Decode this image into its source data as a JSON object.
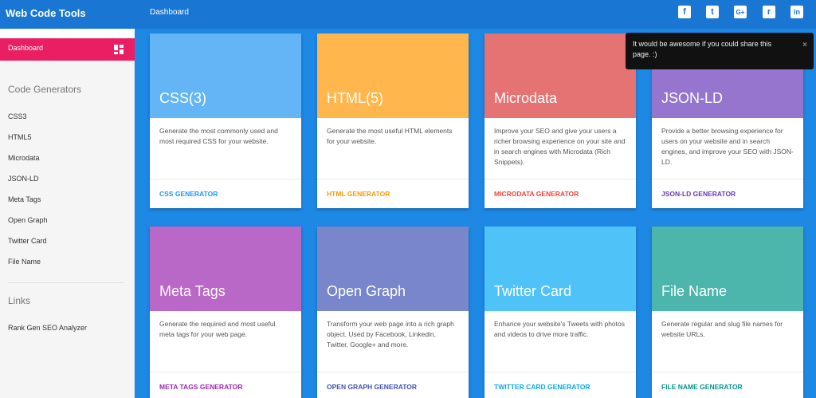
{
  "app": {
    "title": "Web Code Tools"
  },
  "breadcrumb": "Dashboard",
  "social": [
    {
      "name": "facebook-icon",
      "glyph": "f"
    },
    {
      "name": "twitter-icon",
      "glyph": "t"
    },
    {
      "name": "google-plus-icon",
      "glyph": "G+"
    },
    {
      "name": "reddit-icon",
      "glyph": "r"
    },
    {
      "name": "linkedin-icon",
      "glyph": "in"
    }
  ],
  "sidebar": {
    "dashboard_label": "Dashboard",
    "code_generators_title": "Code Generators",
    "items": [
      "CSS3",
      "HTML5",
      "Microdata",
      "JSON-LD",
      "Meta Tags",
      "Open Graph",
      "Twitter Card",
      "File Name"
    ],
    "links_title": "Links",
    "links": [
      "Rank Gen SEO Analyzer"
    ]
  },
  "cards": [
    {
      "title": "CSS(3)",
      "text": "Generate the most commonly used and most required CSS for your website.",
      "link": "CSS GENERATOR",
      "color": "#64b5f6",
      "link_color": "#2196f3"
    },
    {
      "title": "HTML(5)",
      "text": "Generate the most useful HTML elements for your website.",
      "link": "HTML GENERATOR",
      "color": "#ffb74d",
      "link_color": "#ff9800"
    },
    {
      "title": "Microdata",
      "text": "Improve your SEO and give your users a richer browsing experience on your site and in search engines with Microdata (Rich Snippets).",
      "link": "MICRODATA GENERATOR",
      "color": "#e57373",
      "link_color": "#f44336"
    },
    {
      "title": "JSON-LD",
      "text": "Provide a better browsing experience for users on your website and in search engines, and improve your SEO with JSON-LD.",
      "link": "JSON-LD GENERATOR",
      "color": "#9575cd",
      "link_color": "#673ab7"
    },
    {
      "title": "Meta Tags",
      "text": "Generate the required and most useful meta tags for your web page.",
      "link": "META TAGS GENERATOR",
      "color": "#ba68c8",
      "link_color": "#9c27b0"
    },
    {
      "title": "Open Graph",
      "text": "Transform your web page into a rich graph object. Used by Facebook, Linkedin, Twitter, Google+ and more.",
      "link": "OPEN GRAPH GENERATOR",
      "color": "#7986cb",
      "link_color": "#3f51b5"
    },
    {
      "title": "Twitter Card",
      "text": "Enhance your website's Tweets with photos and videos to drive more traffic.",
      "link": "TWITTER CARD GENERATOR",
      "color": "#4fc3f7",
      "link_color": "#03a9f4"
    },
    {
      "title": "File Name",
      "text": "Generate regular and slug file names for website URLs.",
      "link": "FILE NAME GENERATOR",
      "color": "#4db6ac",
      "link_color": "#009688"
    }
  ],
  "toast": {
    "message": "It would be awesome if you could share this page. :)",
    "close": "×"
  }
}
